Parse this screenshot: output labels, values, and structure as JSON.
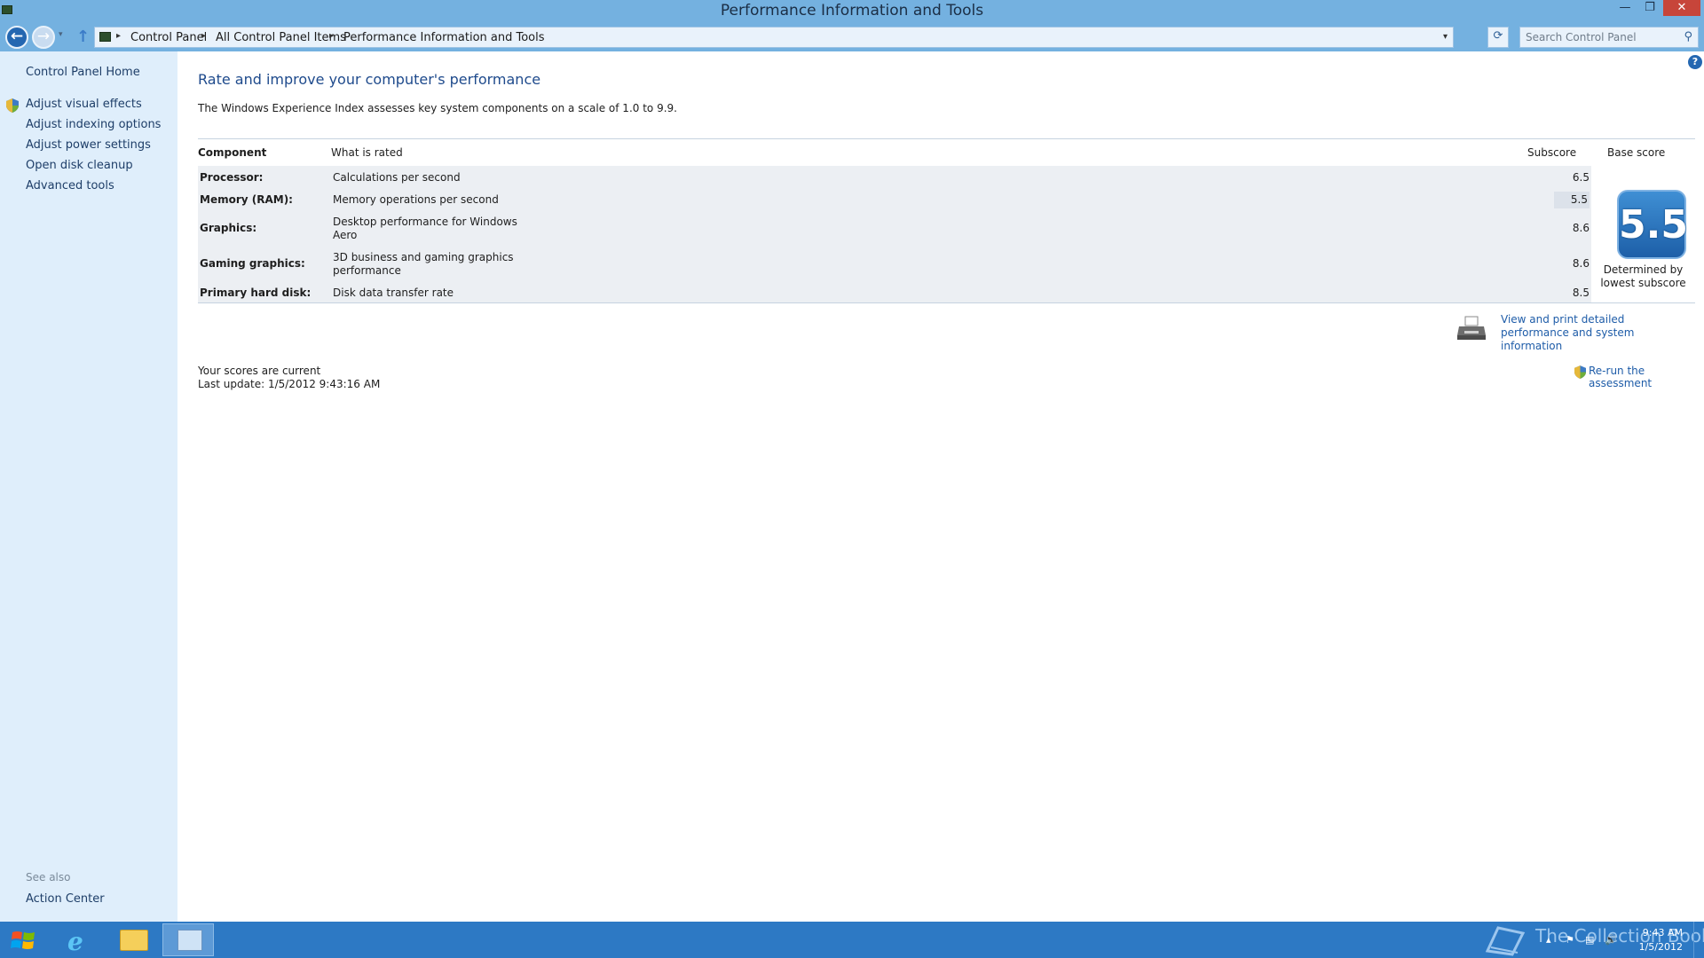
{
  "window": {
    "title": "Performance Information and Tools",
    "minimize_glyph": "—",
    "maximize_glyph": "❐",
    "close_glyph": "✕"
  },
  "nav": {
    "back_glyph": "←",
    "forward_glyph": "→",
    "history_glyph": "▾",
    "up_glyph": "↑",
    "breadcrumbs": [
      "Control Panel",
      "All Control Panel Items",
      "Performance Information and Tools"
    ],
    "crumb_separator": "▸",
    "address_drop_glyph": "▾",
    "refresh_glyph": "⟳",
    "search_placeholder": "Search Control Panel",
    "search_glyph": "⚲"
  },
  "sidebar": {
    "home_link": "Control Panel Home",
    "links": [
      "Adjust visual effects",
      "Adjust indexing options",
      "Adjust power settings",
      "Open disk cleanup",
      "Advanced tools"
    ],
    "see_also_label": "See also",
    "see_also_links": [
      "Action Center"
    ]
  },
  "main": {
    "help_glyph": "?",
    "title": "Rate and improve your computer's performance",
    "intro": "The Windows Experience Index assesses key system components on a scale of 1.0 to 9.9.",
    "table": {
      "headers": {
        "component": "Component",
        "rated": "What is rated",
        "subscore": "Subscore",
        "base": "Base score"
      },
      "rows": [
        {
          "component": "Processor:",
          "rated": "Calculations per second",
          "subscore": "6.5"
        },
        {
          "component": "Memory (RAM):",
          "rated": "Memory operations per second",
          "subscore": "5.5"
        },
        {
          "component": "Graphics:",
          "rated": "Desktop performance for Windows Aero",
          "subscore": "8.6"
        },
        {
          "component": "Gaming graphics:",
          "rated": "3D business and gaming graphics performance",
          "subscore": "8.6"
        },
        {
          "component": "Primary hard disk:",
          "rated": "Disk data transfer rate",
          "subscore": "8.5"
        }
      ],
      "base_score": "5.5",
      "base_caption": "Determined by lowest subscore"
    },
    "print_link": "View and print detailed performance and system information",
    "status": "Your scores are current",
    "last_update": "Last update: 1/5/2012 9:43:16 AM",
    "rerun_link": "Re-run the assessment"
  },
  "taskbar": {
    "ie_glyph": "e",
    "watermark": "The Collection Book",
    "tray_glyphs": [
      "▴",
      "⚑",
      "▤",
      "🔊"
    ],
    "time": "9:43 AM",
    "date": "1/5/2012"
  },
  "colors": {
    "chrome": "#74b1e0",
    "sidebar": "#dfeefb",
    "link": "#1e5ca8",
    "title": "#1e4a8c",
    "taskbar": "#2d79c4"
  }
}
